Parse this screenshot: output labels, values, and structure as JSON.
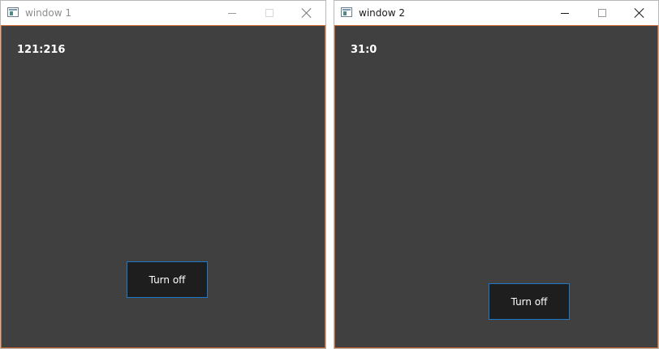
{
  "windows": [
    {
      "title": "window 1",
      "counter": "121:216",
      "button_label": "Turn off",
      "active": false
    },
    {
      "title": "window 2",
      "counter": "31:0",
      "button_label": "Turn off",
      "active": true
    }
  ],
  "icons": {
    "app": "app-window-icon",
    "minimize": "minimize-icon",
    "maximize": "maximize-icon",
    "close": "close-icon"
  },
  "colors": {
    "client_background": "#404040",
    "window_border": "#c9652a",
    "button_background": "#1e1e1e",
    "button_border": "#1e78c8",
    "text": "#ffffff"
  }
}
